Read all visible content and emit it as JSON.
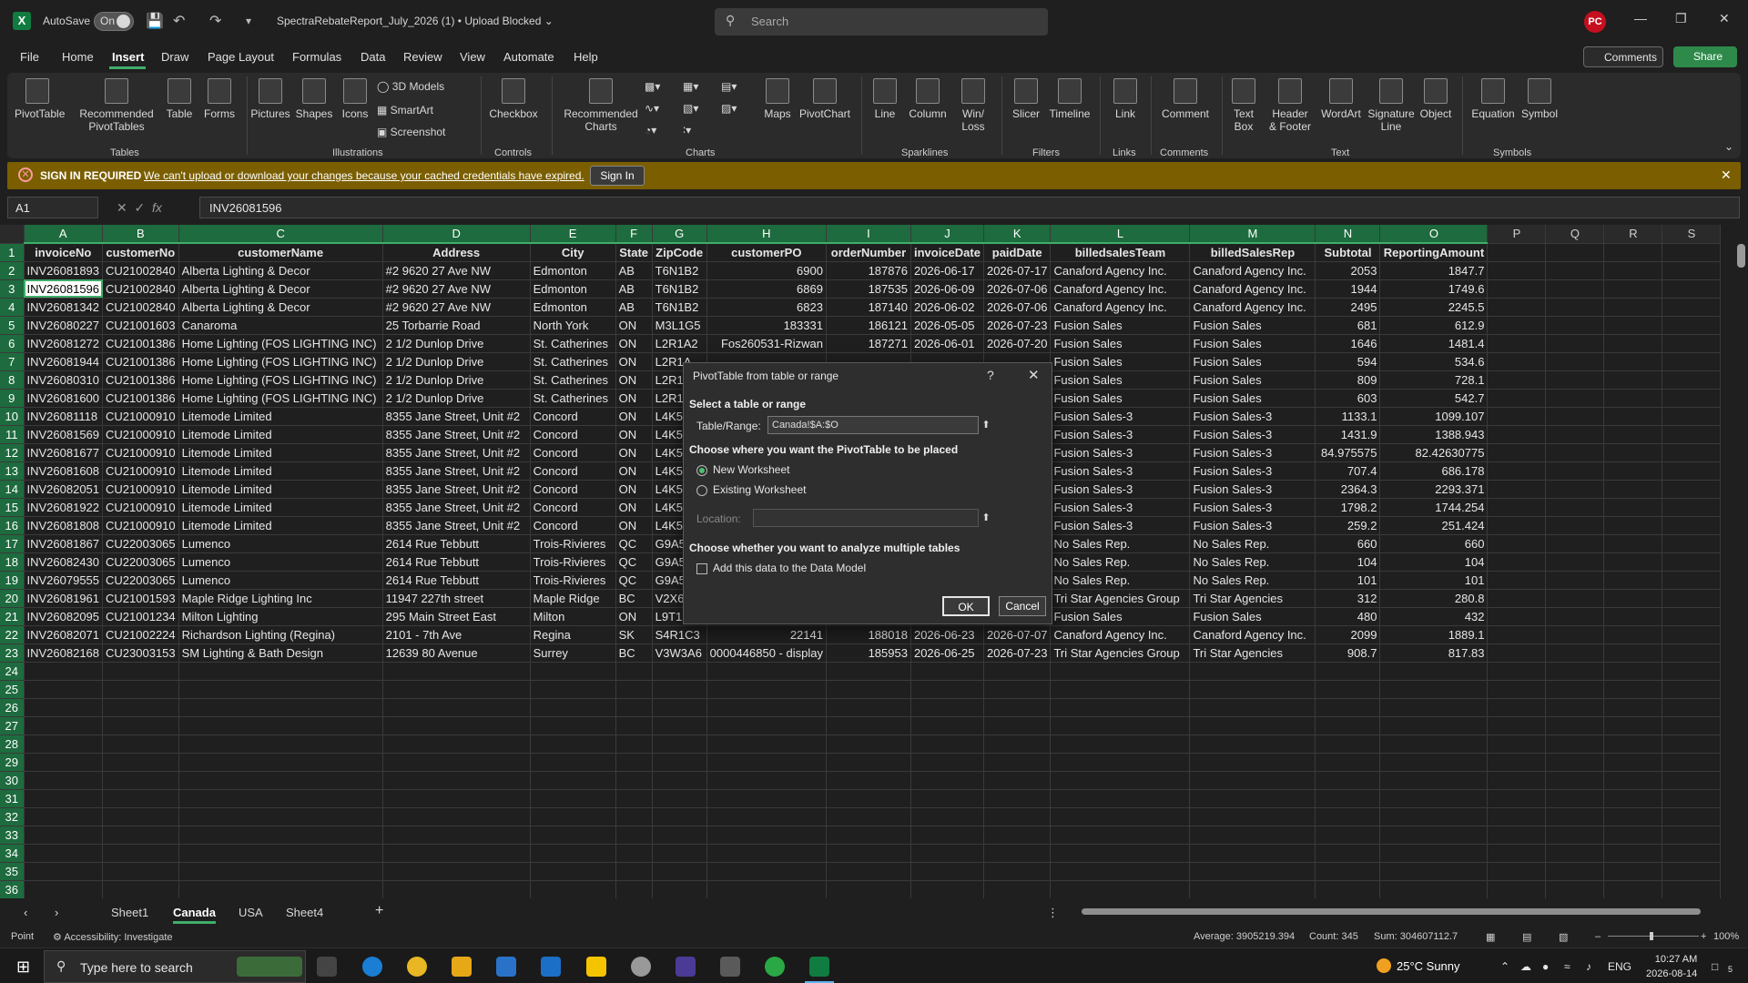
{
  "titlebar": {
    "app_icon": "X",
    "autosave_label": "AutoSave",
    "autosave_state": "On",
    "doc_title": "SpectraRebateReport_July_2026 (1) • Upload Blocked ⌄",
    "search_placeholder": "Search",
    "avatar_initials": "PC"
  },
  "menu": {
    "tabs": [
      "File",
      "Home",
      "Insert",
      "Draw",
      "Page Layout",
      "Formulas",
      "Data",
      "Review",
      "View",
      "Automate",
      "Help"
    ],
    "active": "Insert",
    "comments_label": "Comments",
    "share_label": "Share"
  },
  "ribbon": {
    "pivottable": "PivotTable",
    "recommended_pivot_1": "Recommended",
    "recommended_pivot_2": "PivotTables",
    "table": "Table",
    "forms": "Forms",
    "pictures": "Pictures",
    "shapes": "Shapes",
    "icons": "Icons",
    "models3d": "3D Models",
    "smartart": "SmartArt",
    "screenshot": "Screenshot",
    "checkbox": "Checkbox",
    "recommended_charts_1": "Recommended",
    "recommended_charts_2": "Charts",
    "maps": "Maps",
    "pivotchart": "PivotChart",
    "line": "Line",
    "column": "Column",
    "winloss_1": "Win/",
    "winloss_2": "Loss",
    "slicer": "Slicer",
    "timeline": "Timeline",
    "link": "Link",
    "comment": "Comment",
    "textbox_1": "Text",
    "textbox_2": "Box",
    "headerfooter_1": "Header",
    "headerfooter_2": "& Footer",
    "wordart": "WordArt",
    "signature_1": "Signature",
    "signature_2": "Line",
    "object": "Object",
    "equation": "Equation",
    "symbol": "Symbol",
    "groups": {
      "tables": "Tables",
      "illustrations": "Illustrations",
      "controls": "Controls",
      "charts": "Charts",
      "sparklines": "Sparklines",
      "filters": "Filters",
      "links": "Links",
      "comments": "Comments",
      "text": "Text",
      "symbols": "Symbols"
    }
  },
  "infobar": {
    "title": "SIGN IN REQUIRED",
    "message": "We can't upload or download your changes because your cached credentials have expired.",
    "button": "Sign In"
  },
  "formula_bar": {
    "name_box": "A1",
    "formula": "INV26081596"
  },
  "grid": {
    "columns": [
      "A",
      "B",
      "C",
      "D",
      "E",
      "F",
      "G",
      "H",
      "I",
      "J",
      "K",
      "L",
      "M",
      "N",
      "O",
      "P",
      "Q",
      "R",
      "S"
    ],
    "headers": [
      "invoiceNo",
      "customerNo",
      "customerName",
      "Address",
      "City",
      "State",
      "ZipCode",
      "customerPO",
      "orderNumber",
      "invoiceDate",
      "paidDate",
      "billedsalesTeam",
      "billedSalesRep",
      "Subtotal",
      "ReportingAmount"
    ],
    "rows": [
      [
        "INV26081893",
        "CU21002840",
        "Alberta Lighting & Decor",
        "#2 9620 27 Ave NW",
        "Edmonton",
        "AB",
        "T6N1B2",
        "6900",
        "187876",
        "2026-06-17",
        "2026-07-17",
        "Canaford Agency Inc.",
        "Canaford Agency Inc.",
        "2053",
        "1847.7"
      ],
      [
        "INV26081596",
        "CU21002840",
        "Alberta Lighting & Decor",
        "#2 9620 27 Ave NW",
        "Edmonton",
        "AB",
        "T6N1B2",
        "6869",
        "187535",
        "2026-06-09",
        "2026-07-06",
        "Canaford Agency Inc.",
        "Canaford Agency Inc.",
        "1944",
        "1749.6"
      ],
      [
        "INV26081342",
        "CU21002840",
        "Alberta Lighting & Decor",
        "#2 9620 27 Ave NW",
        "Edmonton",
        "AB",
        "T6N1B2",
        "6823",
        "187140",
        "2026-06-02",
        "2026-07-06",
        "Canaford Agency Inc.",
        "Canaford Agency Inc.",
        "2495",
        "2245.5"
      ],
      [
        "INV26080227",
        "CU21001603",
        "Canaroma",
        "25 Torbarrie Road",
        "North York",
        "ON",
        "M3L1G5",
        "183331",
        "186121",
        "2026-05-05",
        "2026-07-23",
        "Fusion Sales",
        "Fusion Sales",
        "681",
        "612.9"
      ],
      [
        "INV26081272",
        "CU21001386",
        "Home Lighting (FOS LIGHTING INC)",
        "2 1/2 Dunlop Drive",
        "St. Catherines",
        "ON",
        "L2R1A2",
        "Fos260531-Rizwan",
        "187271",
        "2026-06-01",
        "2026-07-20",
        "Fusion Sales",
        "Fusion Sales",
        "1646",
        "1481.4"
      ],
      [
        "INV26081944",
        "CU21001386",
        "Home Lighting (FOS LIGHTING INC)",
        "2 1/2 Dunlop Drive",
        "St. Catherines",
        "ON",
        "L2R1A",
        "",
        "",
        "",
        "",
        "Fusion Sales",
        "Fusion Sales",
        "594",
        "534.6"
      ],
      [
        "INV26080310",
        "CU21001386",
        "Home Lighting (FOS LIGHTING INC)",
        "2 1/2 Dunlop Drive",
        "St. Catherines",
        "ON",
        "L2R1A",
        "",
        "",
        "",
        "",
        "Fusion Sales",
        "Fusion Sales",
        "809",
        "728.1"
      ],
      [
        "INV26081600",
        "CU21001386",
        "Home Lighting (FOS LIGHTING INC)",
        "2 1/2 Dunlop Drive",
        "St. Catherines",
        "ON",
        "L2R1A",
        "",
        "",
        "",
        "",
        "Fusion Sales",
        "Fusion Sales",
        "603",
        "542.7"
      ],
      [
        "INV26081118",
        "CU21000910",
        "Litemode Limited",
        "8355 Jane Street,  Unit #2",
        "Concord",
        "ON",
        "L4K5",
        "",
        "",
        "",
        "",
        "Fusion Sales-3",
        "Fusion Sales-3",
        "1133.1",
        "1099.107"
      ],
      [
        "INV26081569",
        "CU21000910",
        "Litemode Limited",
        "8355 Jane Street,  Unit #2",
        "Concord",
        "ON",
        "L4K5",
        "",
        "",
        "",
        "",
        "Fusion Sales-3",
        "Fusion Sales-3",
        "1431.9",
        "1388.943"
      ],
      [
        "INV26081677",
        "CU21000910",
        "Litemode Limited",
        "8355 Jane Street,  Unit #2",
        "Concord",
        "ON",
        "L4K5",
        "",
        "",
        "",
        "",
        "Fusion Sales-3",
        "Fusion Sales-3",
        "84.975575",
        "82.42630775"
      ],
      [
        "INV26081608",
        "CU21000910",
        "Litemode Limited",
        "8355 Jane Street,  Unit #2",
        "Concord",
        "ON",
        "L4K5",
        "",
        "",
        "",
        "",
        "Fusion Sales-3",
        "Fusion Sales-3",
        "707.4",
        "686.178"
      ],
      [
        "INV26082051",
        "CU21000910",
        "Litemode Limited",
        "8355 Jane Street,  Unit #2",
        "Concord",
        "ON",
        "L4K5",
        "",
        "",
        "",
        "",
        "Fusion Sales-3",
        "Fusion Sales-3",
        "2364.3",
        "2293.371"
      ],
      [
        "INV26081922",
        "CU21000910",
        "Litemode Limited",
        "8355 Jane Street,  Unit #2",
        "Concord",
        "ON",
        "L4K5",
        "",
        "",
        "",
        "",
        "Fusion Sales-3",
        "Fusion Sales-3",
        "1798.2",
        "1744.254"
      ],
      [
        "INV26081808",
        "CU21000910",
        "Litemode Limited",
        "8355 Jane Street,  Unit #2",
        "Concord",
        "ON",
        "L4K5",
        "",
        "",
        "",
        "",
        "Fusion Sales-3",
        "Fusion Sales-3",
        "259.2",
        "251.424"
      ],
      [
        "INV26081867",
        "CU22003065",
        "Lumenco",
        "2614 Rue Tebbutt",
        "Trois-Rivieres",
        "QC",
        "G9A5",
        "",
        "",
        "",
        "",
        "No Sales Rep.",
        "No Sales Rep.",
        "660",
        "660"
      ],
      [
        "INV26082430",
        "CU22003065",
        "Lumenco",
        "2614 Rue Tebbutt",
        "Trois-Rivieres",
        "QC",
        "G9A5",
        "",
        "",
        "",
        "",
        "No Sales Rep.",
        "No Sales Rep.",
        "104",
        "104"
      ],
      [
        "INV26079555",
        "CU22003065",
        "Lumenco",
        "2614 Rue Tebbutt",
        "Trois-Rivieres",
        "QC",
        "G9A5",
        "",
        "",
        "",
        "",
        "No Sales Rep.",
        "No Sales Rep.",
        "101",
        "101"
      ],
      [
        "INV26081961",
        "CU21001593",
        "Maple Ridge Lighting Inc",
        "11947 227th street",
        "Maple Ridge",
        "BC",
        "V2X6",
        "",
        "",
        "",
        "",
        "Tri Star Agencies Group",
        "Tri Star Agencies",
        "312",
        "280.8"
      ],
      [
        "INV26082095",
        "CU21001234",
        "Milton Lighting",
        "295 Main Street East",
        "Milton",
        "ON",
        "L9T1F",
        "",
        "",
        "",
        "",
        "Fusion Sales",
        "Fusion Sales",
        "480",
        "432"
      ],
      [
        "INV26082071",
        "CU21002224",
        "Richardson Lighting (Regina)",
        "2101 - 7th Ave",
        "Regina",
        "SK",
        "S4R1C3",
        "22141",
        "188018",
        "2026-06-23",
        "2026-07-07",
        "Canaford Agency Inc.",
        "Canaford Agency Inc.",
        "2099",
        "1889.1"
      ],
      [
        "INV26082168",
        "CU23003153",
        "SM Lighting & Bath Design",
        "12639 80 Avenue",
        "Surrey",
        "BC",
        "V3W3A6",
        "0000446850 - display",
        "185953",
        "2026-06-25",
        "2026-07-23",
        "Tri Star Agencies Group",
        "Tri Star Agencies",
        "908.7",
        "817.83"
      ]
    ],
    "row_numbers": [
      "1",
      "2",
      "3",
      "4",
      "5",
      "6",
      "7",
      "8",
      "9",
      "10",
      "11",
      "12",
      "13",
      "14",
      "15",
      "16",
      "17",
      "18",
      "19",
      "20",
      "21",
      "22",
      "23",
      "24",
      "25",
      "26",
      "27",
      "28",
      "29",
      "30",
      "31",
      "32",
      "33",
      "34",
      "35",
      "36"
    ]
  },
  "dialog": {
    "title": "PivotTable from table or range",
    "help": "?",
    "section1": "Select a table or range",
    "table_range_label": "Table/Range:",
    "table_range_value": "Canada!$A:$O",
    "section2": "Choose where you want the PivotTable to be placed",
    "radio_new": "New Worksheet",
    "radio_existing": "Existing Worksheet",
    "location_label": "Location:",
    "section3": "Choose whether you want to analyze multiple tables",
    "checkbox_label": "Add this data to the Data Model",
    "ok": "OK",
    "cancel": "Cancel"
  },
  "sheets": {
    "tabs": [
      "Sheet1",
      "Canada",
      "USA",
      "Sheet4"
    ],
    "active": "Canada",
    "add": "+"
  },
  "status": {
    "mode": "Point",
    "accessibility": "Accessibility: Investigate",
    "average": "Average: 3905219.394",
    "count": "Count: 345",
    "sum": "Sum: 304607112.7",
    "zoom": "100%"
  },
  "taskbar": {
    "search_placeholder": "Type here to search",
    "weather": "25°C  Sunny",
    "lang": "ENG",
    "time": "10:27 AM",
    "date": "2026-08-14",
    "notif_count": "5"
  },
  "colors": {
    "accent_green": "#3fae6a",
    "infobar": "#7a5e00",
    "excel_green": "#107c41"
  }
}
